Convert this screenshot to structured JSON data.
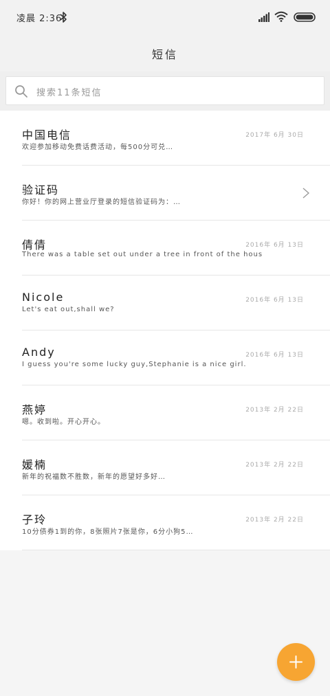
{
  "status_bar": {
    "time": "凌晨 2:36",
    "icons": [
      "bluetooth-icon",
      "signal-icon",
      "wifi-icon",
      "battery-icon"
    ]
  },
  "header": {
    "title": "短信"
  },
  "search": {
    "placeholder": "搜索11条短信"
  },
  "messages": [
    {
      "name": "中国电信",
      "date": "2017年 6月 30日",
      "snippet": "欢迎参加移动免费话费活动，每500分可兑…"
    },
    {
      "name": "验证码",
      "date": "",
      "snippet": "你好！你的网上营业厅登录的短信验证码为：…",
      "has_chevron": true
    },
    {
      "name": "倩倩",
      "date": "2016年 6月 13日",
      "snippet": "There was a table set out under a tree in front of the hous"
    },
    {
      "name": "Nicole",
      "date": "2016年 6月 13日",
      "snippet": "Let's eat out,shall we?"
    },
    {
      "name": "Andy",
      "date": "2016年 6月 13日",
      "snippet": "I guess you're some lucky guy,Stephanie is a nice girl."
    },
    {
      "name": "燕婷",
      "date": "2013年 2月 22日",
      "snippet": "嗯。收到啦。开心开心。"
    },
    {
      "name": "媛楠",
      "date": "2013年 2月 22日",
      "snippet": "新年的祝福数不胜数，新年的愿望好多好…"
    },
    {
      "name": "子玲",
      "date": "2013年 2月 22日",
      "snippet": "10分债券1到的你，8张照片7张是你，6分小狗5…"
    }
  ],
  "colors": {
    "accent": "#f7a532",
    "header_bg": "#f2f2f2",
    "list_bg": "#ffffff"
  },
  "fab": {
    "icon": "plus-icon"
  }
}
